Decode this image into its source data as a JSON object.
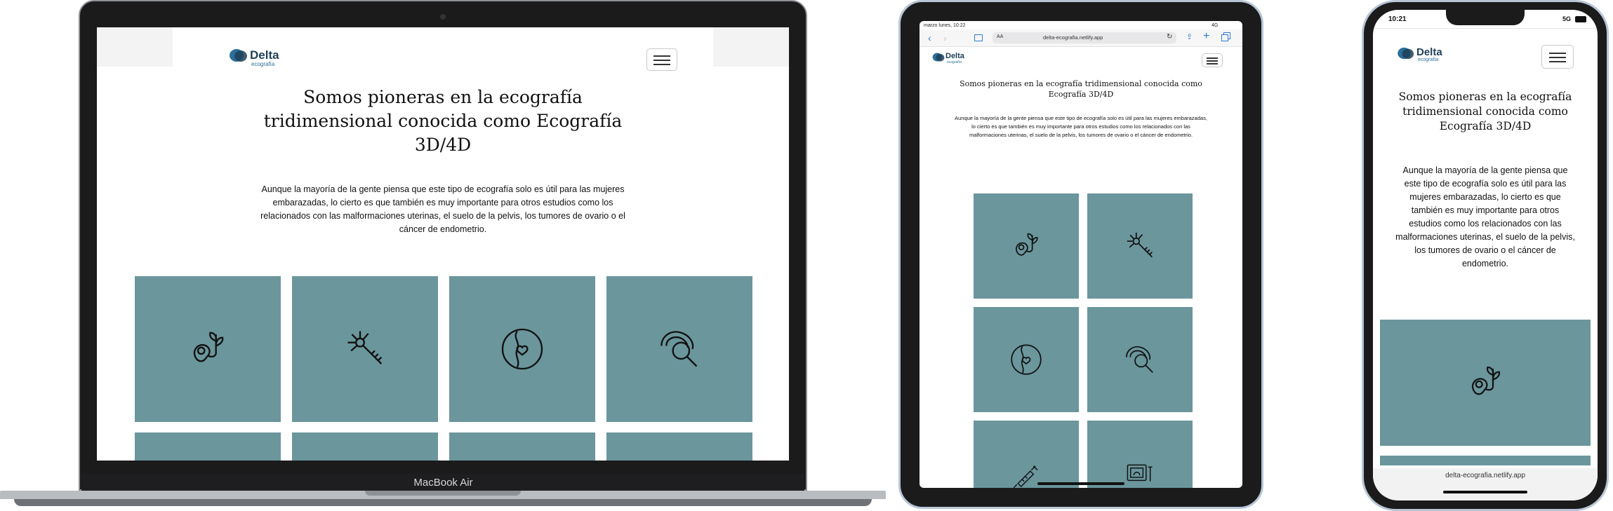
{
  "brand": {
    "name": "Delta",
    "tagline": "ecografía"
  },
  "page": {
    "heading": "Somos pioneras en la ecografía tridimensional conocida como Ecografía 3D/4D",
    "intro": "Aunque la mayoría de la gente piensa que este tipo de ecografía solo es útil para las mujeres embarazadas, lo cierto es que también es muy importante para otros estudios como los relacionados con las malformaciones uterinas, el suelo de la pelvis, los tumores de ovario o el cáncer de endometrio."
  },
  "laptop": {
    "label": "MacBook Air"
  },
  "tablet": {
    "status_time": "marzo lunes, 10:22",
    "status_signal": "4G",
    "url": "delta-ecografia.netlify.app",
    "aa_label": "AA"
  },
  "phone": {
    "status_time": "10:21",
    "status_signal": "5G",
    "url": "delta-ecografia.netlify.app"
  },
  "tile_icons": [
    "fetus-icon",
    "neuron-icon",
    "uterus-icon",
    "ovary-magnifier-icon",
    "syringe-icon",
    "ultrasound-monitor-icon"
  ],
  "colors": {
    "tile": "#6a969c",
    "device_frame": "#1b1b1c",
    "laptop_body": "#b9bcc1",
    "accent": "#2b6f9b"
  }
}
